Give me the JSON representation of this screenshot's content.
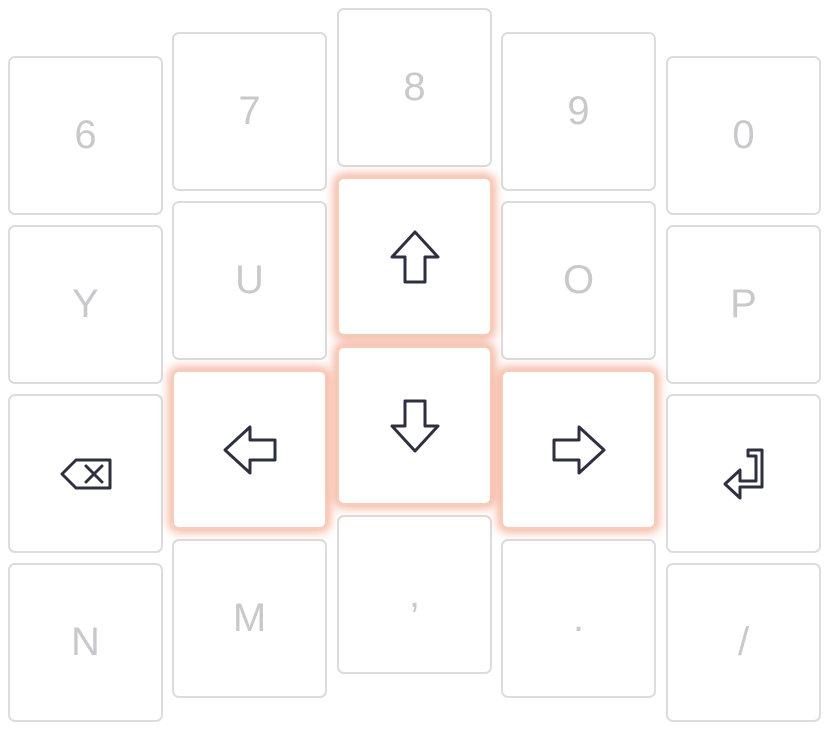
{
  "keys": {
    "six": "6",
    "seven": "7",
    "eight": "8",
    "nine": "9",
    "zero": "0",
    "y": "Y",
    "u": "U",
    "o": "O",
    "p": "P",
    "n": "N",
    "m": "M",
    "comma": ",",
    "period": ".",
    "slash": "/"
  },
  "icons": {
    "up": "arrow-up-icon",
    "down": "arrow-down-icon",
    "left": "arrow-left-icon",
    "right": "arrow-right-icon",
    "backspace": "backspace-icon",
    "enter": "enter-icon"
  },
  "highlighted_keys": [
    "up",
    "down",
    "left",
    "right"
  ],
  "colors": {
    "key_text": "#c9c9cd",
    "key_border": "#dcdcdf",
    "icon_stroke": "#2e3040",
    "highlight_glow": "#f07850"
  }
}
